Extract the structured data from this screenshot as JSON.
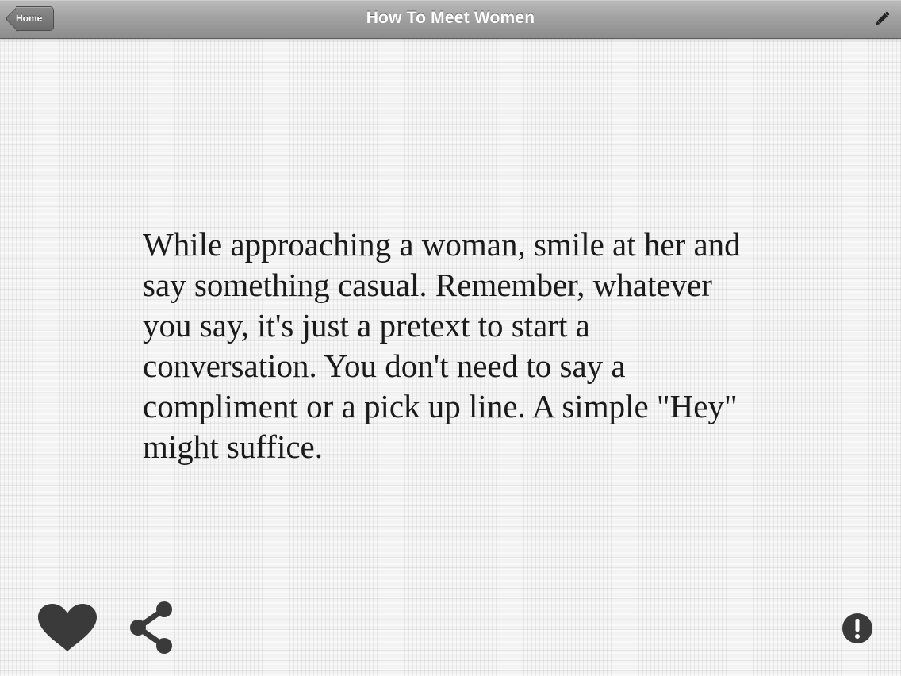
{
  "header": {
    "title": "How To Meet Women",
    "back_button_label": "Home",
    "edit_icon": "pencil-icon"
  },
  "content": {
    "quote": "While approaching a woman, smile at her and say something casual. Remember, whatever you say, it's just a pretext to start a conversation. You don't need to say a compliment or a pick up line. A simple \"Hey\" might suffice."
  },
  "footer": {
    "favorite_icon": "heart-icon",
    "share_icon": "share-icon",
    "report_icon": "exclamation-icon"
  },
  "colors": {
    "navbar": "#a2a2a2",
    "text": "#1a1a1a",
    "icons": "#3a3a3a"
  }
}
